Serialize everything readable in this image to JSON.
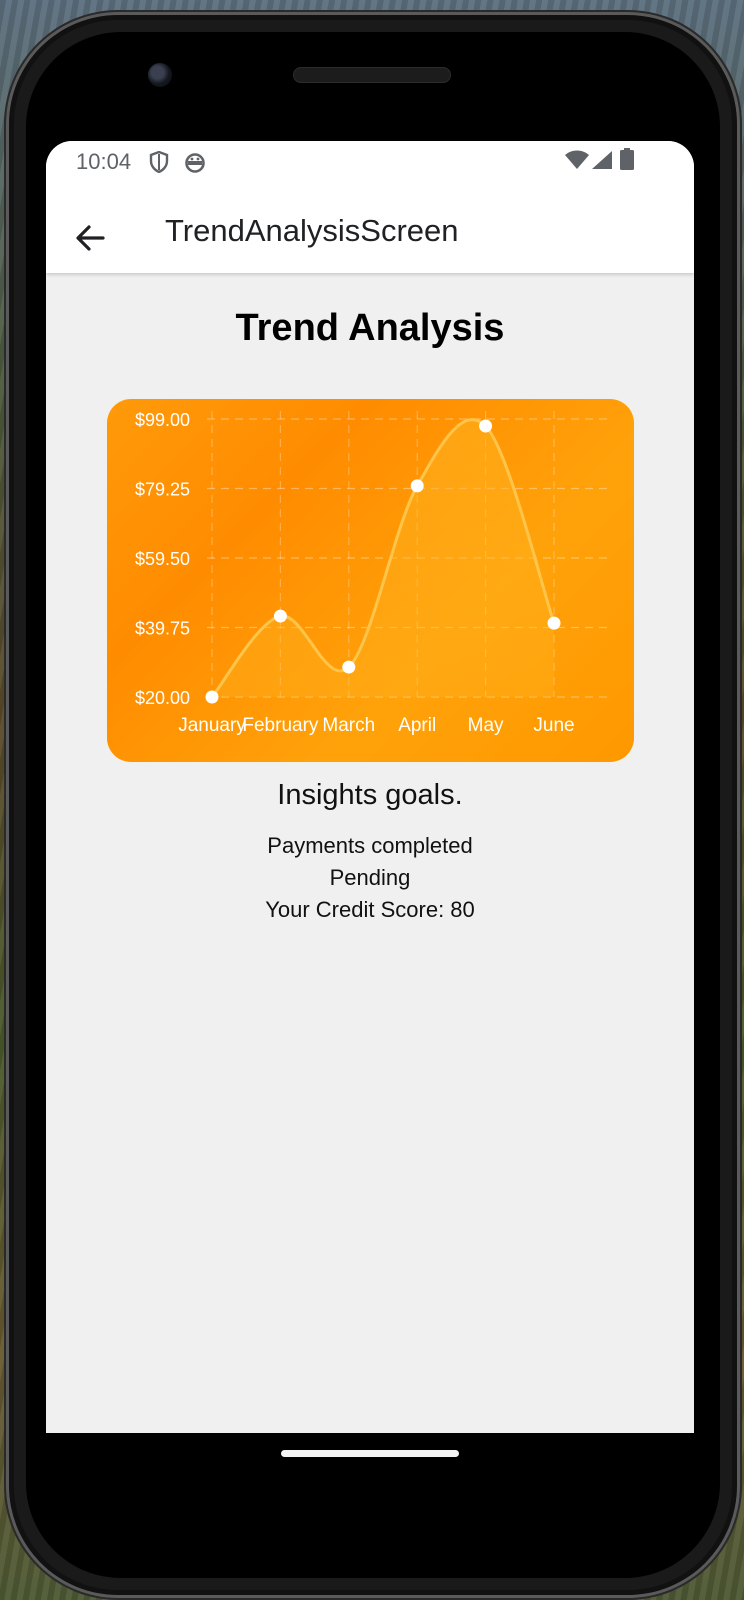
{
  "status_bar": {
    "time": "10:04",
    "left_icons": [
      "shield-icon",
      "android-face-icon"
    ],
    "right_icons": [
      "wifi-icon",
      "cellular-signal-icon",
      "battery-icon"
    ]
  },
  "app_bar": {
    "title": "TrendAnalysisScreen",
    "back_icon": "arrow-left-icon"
  },
  "page": {
    "heading": "Trend Analysis",
    "insights": "Insights goals.",
    "payments": "Payments completed",
    "pending": "Pending",
    "credit_score": "Your Credit Score: 80"
  },
  "colors": {
    "chart_gradient_start": "#ff8c00",
    "chart_gradient_end": "#ffa20a",
    "line": "#ffc54a",
    "point": "#ffffff"
  },
  "chart_data": {
    "type": "line",
    "categories": [
      "January",
      "February",
      "March",
      "April",
      "May",
      "June"
    ],
    "values": [
      20,
      43,
      28.5,
      80,
      97,
      41
    ],
    "y_ticks": [
      "$20.00",
      "$39.75",
      "$59.50",
      "$79.25",
      "$99.00"
    ],
    "ylim": [
      20,
      99
    ],
    "smooth": true,
    "area_fill": true,
    "grid": true,
    "title": "",
    "xlabel": "",
    "ylabel": ""
  }
}
